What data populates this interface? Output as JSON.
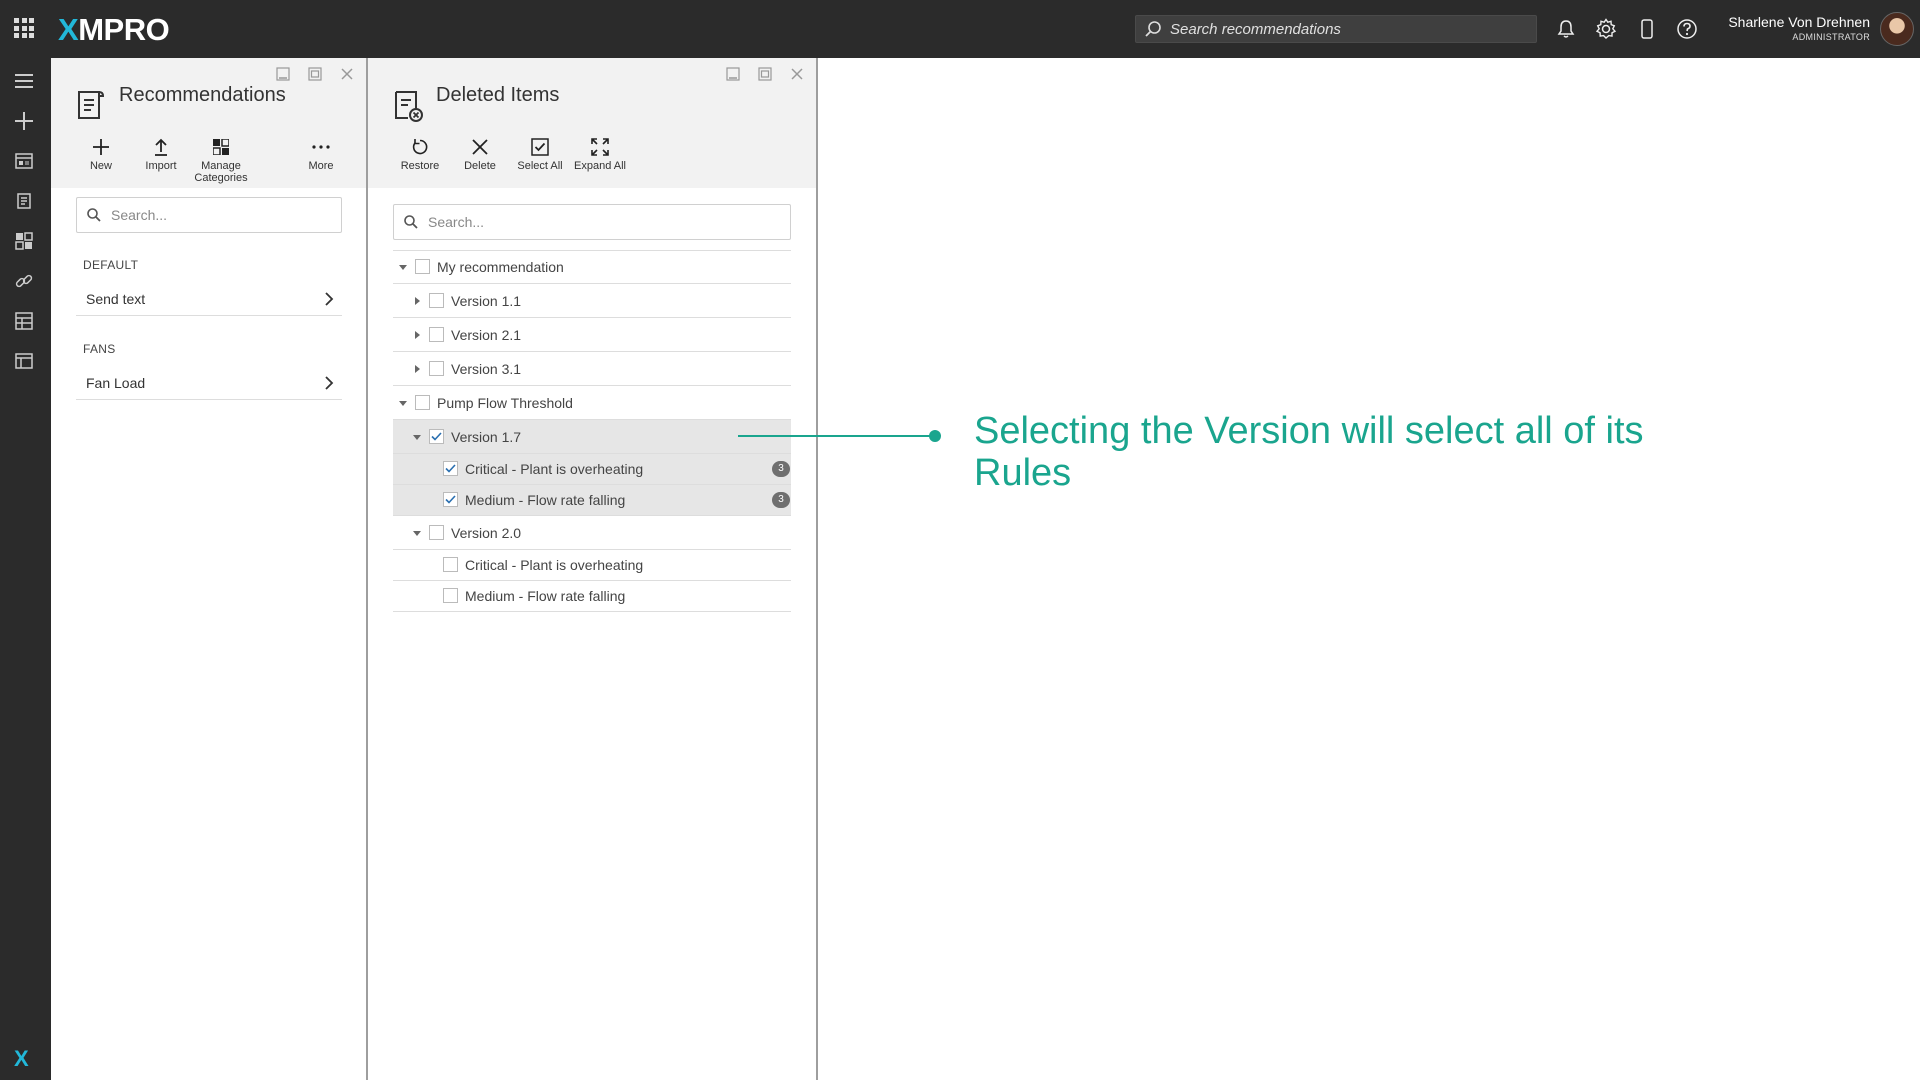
{
  "topbar": {
    "logo_prefix": "X",
    "logo_rest": "MPRO",
    "search_placeholder": "Search recommendations",
    "user_name": "Sharlene Von Drehnen",
    "user_role": "ADMINISTRATOR",
    "icons": [
      "apps-grid-icon",
      "bell-icon",
      "gear-icon",
      "mobile-device-icon",
      "help-icon"
    ]
  },
  "rail": {
    "icons": [
      "hamburger-menu-icon",
      "plus-icon",
      "dashboard-icon",
      "recommendations-icon",
      "grid-widgets-icon",
      "link-icon",
      "data-stream-icon",
      "app-icon"
    ],
    "bottom_logo": "X"
  },
  "recommendations_panel": {
    "title": "Recommendations",
    "toolbar": [
      {
        "label": "New",
        "icon": "plus-icon"
      },
      {
        "label": "Import",
        "icon": "upload-icon"
      },
      {
        "label": "Manage Categories",
        "icon": "categories-icon"
      },
      {
        "label": "More",
        "icon": "more-dots-icon"
      }
    ],
    "search_placeholder": "Search...",
    "categories": [
      {
        "name": "DEFAULT",
        "items": [
          "Send text"
        ]
      },
      {
        "name": "FANS",
        "items": [
          "Fan Load"
        ]
      }
    ]
  },
  "deleted_panel": {
    "title": "Deleted Items",
    "toolbar": [
      {
        "label": "Restore",
        "icon": "restore-icon"
      },
      {
        "label": "Delete",
        "icon": "delete-x-icon"
      },
      {
        "label": "Select All",
        "icon": "select-all-icon"
      },
      {
        "label": "Expand All",
        "icon": "expand-all-icon"
      }
    ],
    "search_placeholder": "Search...",
    "tree": [
      {
        "label": "My recommendation",
        "level": 0,
        "expanded": true,
        "checked": false
      },
      {
        "label": "Version 1.1",
        "level": 1,
        "expanded": false,
        "checked": false
      },
      {
        "label": "Version 2.1",
        "level": 1,
        "expanded": false,
        "checked": false
      },
      {
        "label": "Version 3.1",
        "level": 1,
        "expanded": false,
        "checked": false
      },
      {
        "label": "Pump Flow Threshold",
        "level": 0,
        "expanded": true,
        "checked": false
      },
      {
        "label": "Version 1.7",
        "level": 1,
        "expanded": true,
        "checked": true
      },
      {
        "label": "Critical - Plant is overheating",
        "level": 2,
        "checked": true,
        "badge": "3"
      },
      {
        "label": "Medium - Flow rate falling",
        "level": 2,
        "checked": true,
        "badge": "3"
      },
      {
        "label": "Version 2.0",
        "level": 1,
        "expanded": true,
        "checked": false
      },
      {
        "label": "Critical - Plant is overheating",
        "level": 2,
        "checked": false
      },
      {
        "label": "Medium - Flow rate falling",
        "level": 2,
        "checked": false
      }
    ]
  },
  "annotation": {
    "text": "Selecting the Version will select all of its Rules",
    "color": "#1aa58e"
  }
}
